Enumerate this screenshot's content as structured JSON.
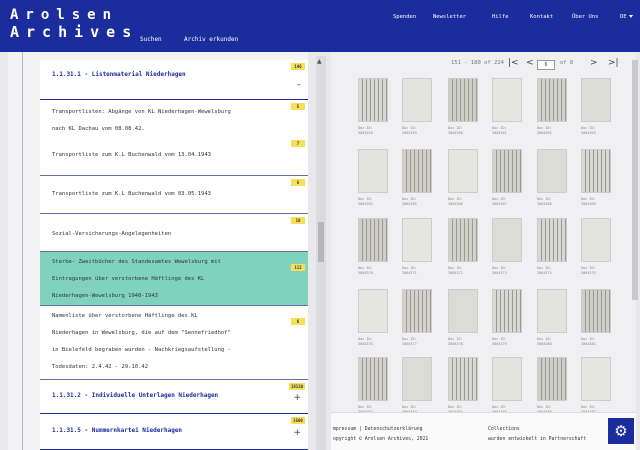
{
  "header": {
    "logo_line1": "Arolsen",
    "logo_line2": "Archives",
    "nav_main": [
      "Suchen",
      "Archiv erkunden"
    ],
    "nav_top": [
      "Spenden",
      "Newsletter",
      "Hilfe",
      "Kontakt",
      "Über Uns",
      "DE"
    ]
  },
  "tree": {
    "items": [
      {
        "label": "1.1.31.1 - Listenmaterial Niederhagen",
        "badge": "146",
        "toggle": "–"
      },
      {
        "label_lines": [
          "Transportlisten: Abgänge von KL Niederhagen-Wewelsburg",
          "nach KL Dachau vom 08.08.42."
        ],
        "badge": "5"
      },
      {
        "label": "Transportliste zum K.L Buchenwald vom 13.04.1943",
        "badge": "7"
      },
      {
        "label": "Transportliste zum K.L Buchenwald vom 03.05.1943",
        "badge": "6"
      },
      {
        "label": "Sozial-Versicherungs-Angelegenheiten",
        "badge": "10"
      },
      {
        "label_lines": [
          "Sterbe- Zweitbücher des Standesamtes Wewelsburg mit",
          "Eintragungen über verstorbene Häftlinge des KL",
          "Niederhagen-Wewelsburg 1940-1943"
        ],
        "badge": "112"
      },
      {
        "label_lines": [
          "Namenliste über verstorbene Häftlinge des KL",
          "Niederhagen in Wewelsburg, die auf dem \"Sennefriedhof\"",
          "in Bielefeld begraben wurden - Nachkriegsaufstellung -",
          "Todesdaten: 2.4.42 - 29.10.42"
        ],
        "badge": "6"
      },
      {
        "label": "1.1.31.2 - Individuelle Unterlagen Niederhagen",
        "badge": "18130",
        "toggle": "+"
      },
      {
        "label": "1.1.31.5 - Nummernkartei Niederhagen",
        "badge": "3500",
        "toggle": "+"
      }
    ]
  },
  "viewer": {
    "range_text": "151 - 180 of 224",
    "first_btn": "|<",
    "prev_btn": "<",
    "page_value": "6",
    "page_of": "of 8",
    "next_btn": ">",
    "last_btn": ">|",
    "thumb_rows": [
      [
        "Doc ID:\n3004358",
        "Doc ID:\n3004359",
        "Doc ID:\n3004360",
        "Doc ID:\n3004361",
        "Doc ID:\n3004362",
        "Doc ID:\n3004363"
      ],
      [
        "Doc ID:\n3004364",
        "Doc ID:\n3004365",
        "Doc ID:\n3004366",
        "Doc ID:\n3004367",
        "Doc ID:\n3004368",
        "Doc ID:\n3004369"
      ],
      [
        "Doc ID:\n3004370",
        "Doc ID:\n3004371",
        "Doc ID:\n3004372",
        "Doc ID:\n3004373",
        "Doc ID:\n3004374",
        "Doc ID:\n3004375"
      ],
      [
        "Doc ID:\n3004376",
        "Doc ID:\n3004377",
        "Doc ID:\n3004378",
        "Doc ID:\n3004379",
        "Doc ID:\n3004380",
        "Doc ID:\n3004381"
      ],
      [
        "Doc ID:\n3004382",
        "Doc ID:\n3004383",
        "Doc ID:\n3004384",
        "Doc ID:\n3004385",
        "Doc ID:\n3004386",
        "Doc ID:\n3004387"
      ]
    ]
  },
  "footer": {
    "links": "mpressum  |  Datenschutzerklärung",
    "copyright": "opyright © Arolsen Archives, 2021",
    "right1": "Collections",
    "right2": "wurden entwickelt in Partnerschaft"
  },
  "settings_icon": "gear-icon"
}
